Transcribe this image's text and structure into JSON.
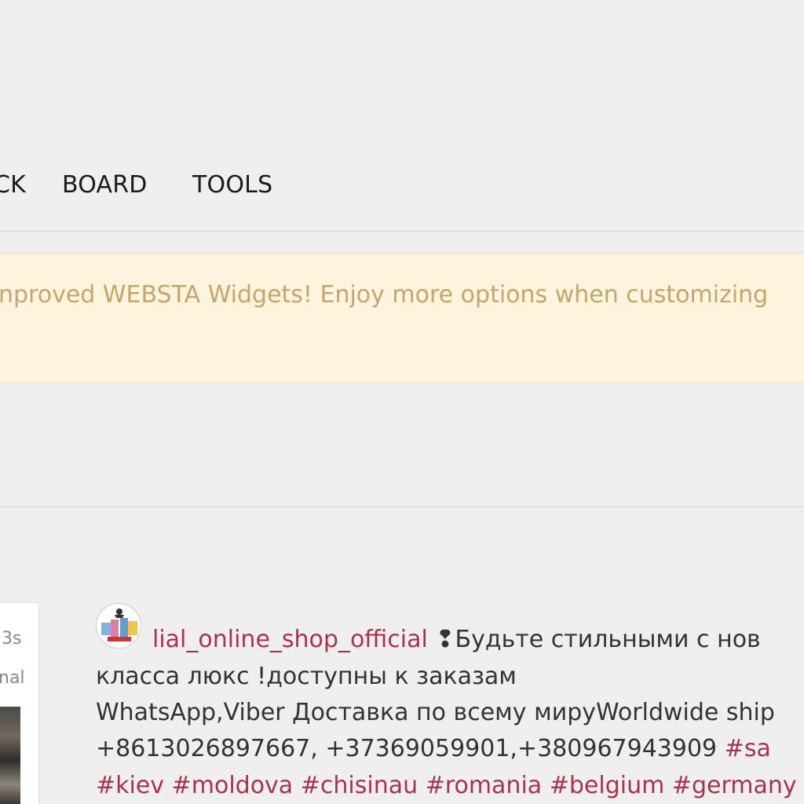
{
  "nav": {
    "items": [
      {
        "label": "CK"
      },
      {
        "label": "BOARD"
      },
      {
        "label": "TOOLS"
      }
    ]
  },
  "notice": {
    "text": "nproved WEBSTA Widgets! Enjoy more options when customizing"
  },
  "left_card": {
    "time": "3s",
    "sub": "nal"
  },
  "post": {
    "username": "lial_online_shop_official",
    "line1_marker": "❢",
    "line1_rest": "Будьте стильными с нов",
    "line2": "класса люкс !доступны к заказам",
    "line3": "WhatsApp,Viber Доставка по всему мируWorldwide ship",
    "line4_text": "+8613026897667, +37369059901,+380967943909 ",
    "line4_tag": "#sa",
    "line5_tags": [
      "#kiev",
      "#moldova",
      "#chisinau",
      "#romania",
      "#belgium",
      "#germany"
    ],
    "colors": {
      "username": "#a8334e",
      "hashtag": "#a8334e"
    }
  }
}
